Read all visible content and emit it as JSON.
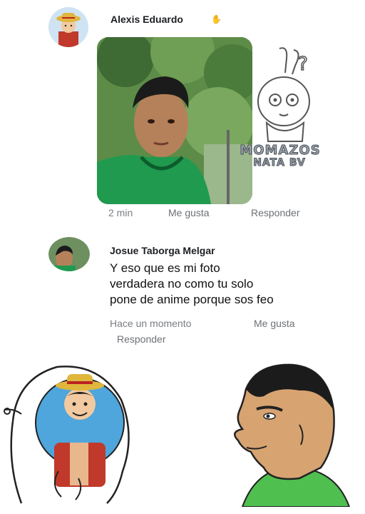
{
  "comment1": {
    "author": "Alexis Eduardo",
    "actions": {
      "time": "2 min",
      "like": "Me gusta",
      "reply": "Responder"
    }
  },
  "watermark": {
    "line1": "MOMAZOS",
    "line2": "NATA BV"
  },
  "comment2": {
    "author": "Josue Taborga Melgar",
    "text_lines": [
      "Y eso que es mi foto",
      "verdadera no como tu solo",
      "pone de anime porque sos feo"
    ],
    "actions": {
      "time": "Hace un momento",
      "like": "Me gusta",
      "reply": "Responder"
    }
  },
  "icons": {
    "avatar1": "luffy-avatar-icon",
    "avatar2": "user-avatar-icon",
    "badge": "hand-icon"
  }
}
